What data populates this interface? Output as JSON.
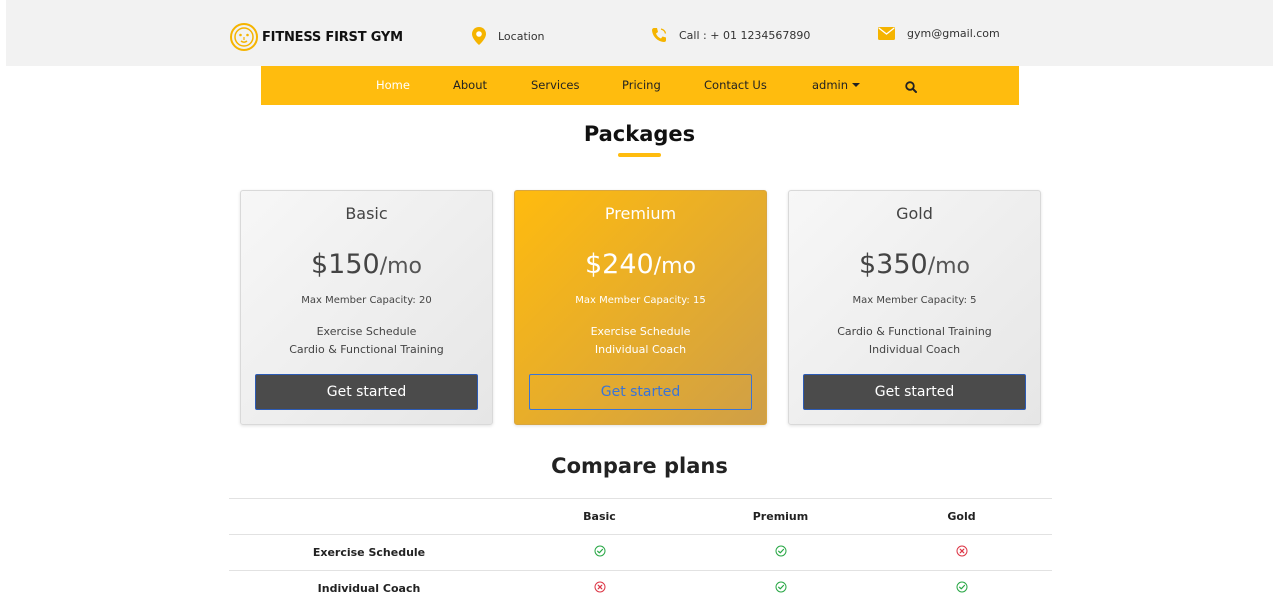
{
  "brand": {
    "name": "FITNESS FIRST GYM",
    "logo_icon": "lion-icon"
  },
  "contact": {
    "location": "Location",
    "call": "Call : + 01 1234567890",
    "email": "gym@gmail.com",
    "location_icon": "map-pin-icon",
    "call_icon": "phone-icon",
    "email_icon": "envelope-icon"
  },
  "nav": {
    "items": [
      "Home",
      "About",
      "Services",
      "Pricing",
      "Contact Us"
    ],
    "active": "Home",
    "user_menu": "admin",
    "search_icon": "search-icon"
  },
  "packages": {
    "title": "Packages",
    "plans": [
      {
        "name": "Basic",
        "price": "$150",
        "period": "/mo",
        "capacity": "Max Member Capacity: 20",
        "features": [
          "Exercise Schedule",
          "Cardio & Functional Training"
        ],
        "button": "Get started"
      },
      {
        "name": "Premium",
        "price": "$240",
        "period": "/mo",
        "capacity": "Max Member Capacity: 15",
        "features": [
          "Exercise Schedule",
          "Individual Coach"
        ],
        "button": "Get started"
      },
      {
        "name": "Gold",
        "price": "$350",
        "period": "/mo",
        "capacity": "Max Member Capacity: 5",
        "features": [
          "Cardio & Functional Training",
          "Individual Coach"
        ],
        "button": "Get started"
      }
    ]
  },
  "compare": {
    "title": "Compare plans",
    "headers": [
      "",
      "Basic",
      "Premium",
      "Gold"
    ],
    "rows": [
      {
        "feature": "Exercise Schedule",
        "marks": [
          "check",
          "check",
          "cross"
        ]
      },
      {
        "feature": "Individual Coach",
        "marks": [
          "cross",
          "check",
          "check"
        ]
      }
    ]
  },
  "colors": {
    "accent": "#ffbc0e",
    "check": "#28a745",
    "cross": "#dc3545",
    "button_dark": "#4b4b4b",
    "button_outline": "#3a74d6"
  }
}
